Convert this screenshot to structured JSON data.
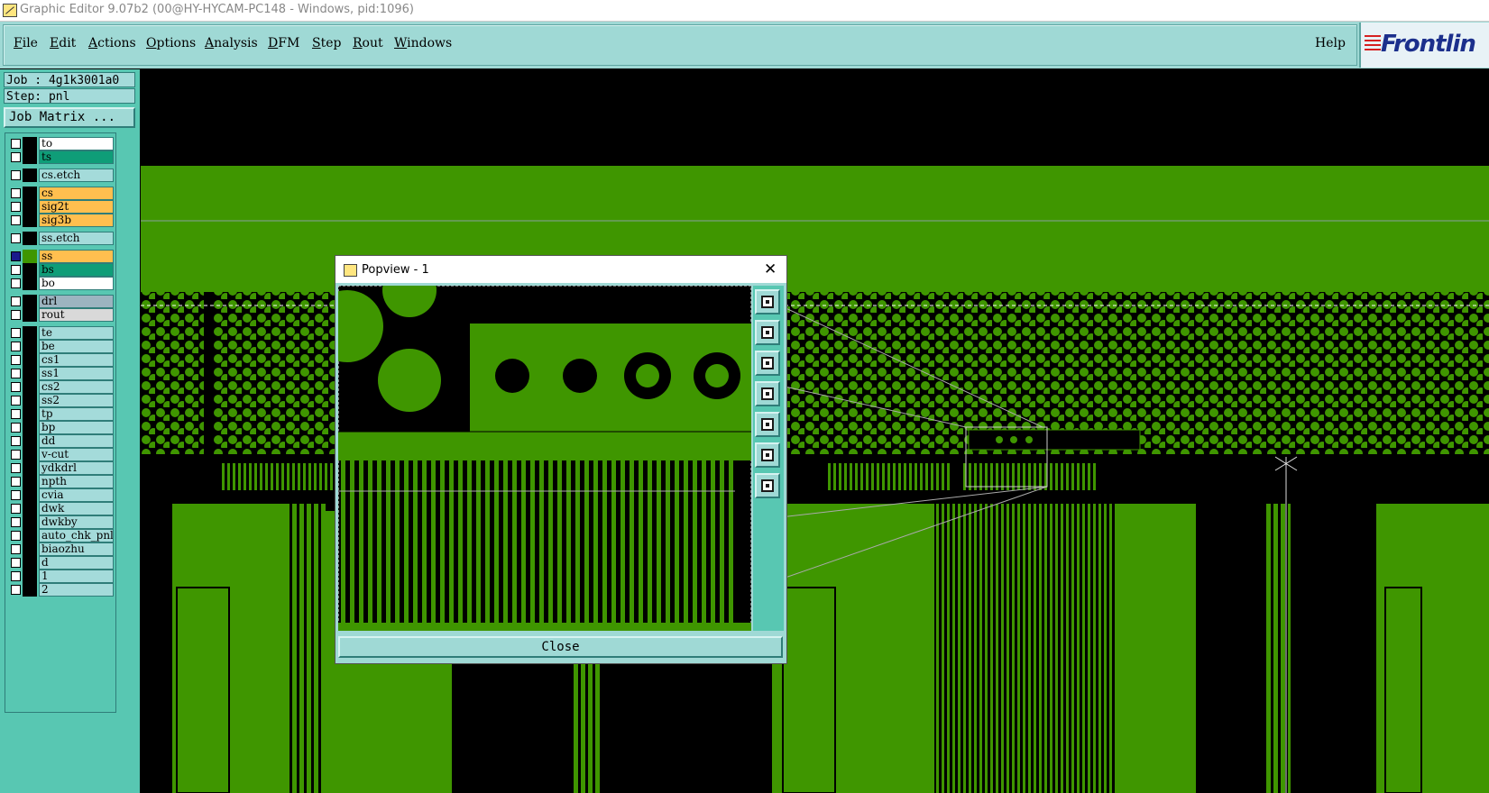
{
  "window": {
    "title": "Graphic Editor 9.07b2 (00@HY-HYCAM-PC148 - Windows, pid:1096)"
  },
  "menu": {
    "items": [
      {
        "label": "File",
        "underline": "F",
        "rest": "ile"
      },
      {
        "label": "Edit",
        "underline": "E",
        "rest": "dit"
      },
      {
        "label": "Actions",
        "underline": "A",
        "rest": "ctions"
      },
      {
        "label": "Options",
        "underline": "O",
        "rest": "ptions"
      },
      {
        "label": "Analysis",
        "underline": "A",
        "rest": "nalysis"
      },
      {
        "label": "DFM",
        "underline": "D",
        "rest": "FM"
      },
      {
        "label": "Step",
        "underline": "S",
        "rest": "tep"
      },
      {
        "label": "Rout",
        "underline": "R",
        "rest": "out"
      },
      {
        "label": "Windows",
        "underline": "W",
        "rest": "indows"
      }
    ],
    "help": "Help"
  },
  "logo": {
    "text": "Frontlin"
  },
  "job": {
    "job_line": "Job : 4g1k3001a0",
    "step_line": "Step: pnl",
    "matrix_button": "Job Matrix ..."
  },
  "layers": [
    {
      "name": "to",
      "color": "#ffffff",
      "checked": false
    },
    {
      "name": "ts",
      "color": "#0f9d78",
      "checked": false
    },
    {
      "name": "cs.etch",
      "color": "#a4dbda",
      "checked": false
    },
    {
      "name": "cs",
      "color": "#ffbf4f",
      "checked": false
    },
    {
      "name": "sig2t",
      "color": "#ffbf4f",
      "checked": false
    },
    {
      "name": "sig3b",
      "color": "#ffbf4f",
      "checked": false
    },
    {
      "name": "ss.etch",
      "color": "#a4dbda",
      "checked": false
    },
    {
      "name": "ss",
      "color": "#ffbf4f",
      "checked": true
    },
    {
      "name": "bs",
      "color": "#0f9d78",
      "checked": false
    },
    {
      "name": "bo",
      "color": "#ffffff",
      "checked": false
    },
    {
      "name": "drl",
      "color": "#9cb4c0",
      "checked": false
    },
    {
      "name": "rout",
      "color": "#d9d9d9",
      "checked": false
    },
    {
      "name": "te",
      "color": "#a4dbda",
      "checked": false
    },
    {
      "name": "be",
      "color": "#a4dbda",
      "checked": false
    },
    {
      "name": "cs1",
      "color": "#a4dbda",
      "checked": false
    },
    {
      "name": "ss1",
      "color": "#a4dbda",
      "checked": false
    },
    {
      "name": "cs2",
      "color": "#a4dbda",
      "checked": false
    },
    {
      "name": "ss2",
      "color": "#a4dbda",
      "checked": false
    },
    {
      "name": "tp",
      "color": "#a4dbda",
      "checked": false
    },
    {
      "name": "bp",
      "color": "#a4dbda",
      "checked": false
    },
    {
      "name": "dd",
      "color": "#a4dbda",
      "checked": false
    },
    {
      "name": "v-cut",
      "color": "#a4dbda",
      "checked": false
    },
    {
      "name": "ydkdrl",
      "color": "#a4dbda",
      "checked": false
    },
    {
      "name": "npth",
      "color": "#a4dbda",
      "checked": false
    },
    {
      "name": "cvia",
      "color": "#a4dbda",
      "checked": false
    },
    {
      "name": "dwk",
      "color": "#a4dbda",
      "checked": false
    },
    {
      "name": "dwkby",
      "color": "#a4dbda",
      "checked": false
    },
    {
      "name": "auto_chk_pnl",
      "color": "#a4dbda",
      "checked": false
    },
    {
      "name": "biaozhu",
      "color": "#a4dbda",
      "checked": false
    },
    {
      "name": "d",
      "color": "#a4dbda",
      "checked": false
    },
    {
      "name": "1",
      "color": "#a4dbda",
      "checked": false
    },
    {
      "name": "2",
      "color": "#a4dbda",
      "checked": false
    }
  ],
  "popview": {
    "title": "Popview - 1",
    "close_label": "Close",
    "tools": [
      "zoom-fit-icon",
      "pan-up-icon",
      "pan-down-icon",
      "pan-left-icon",
      "pan-right-icon",
      "zoom-out-icon",
      "zoom-in-icon"
    ]
  },
  "colors": {
    "board_green": "#3f9600",
    "panel_teal": "#58c7b2",
    "menu_teal": "#9fd9d5"
  }
}
